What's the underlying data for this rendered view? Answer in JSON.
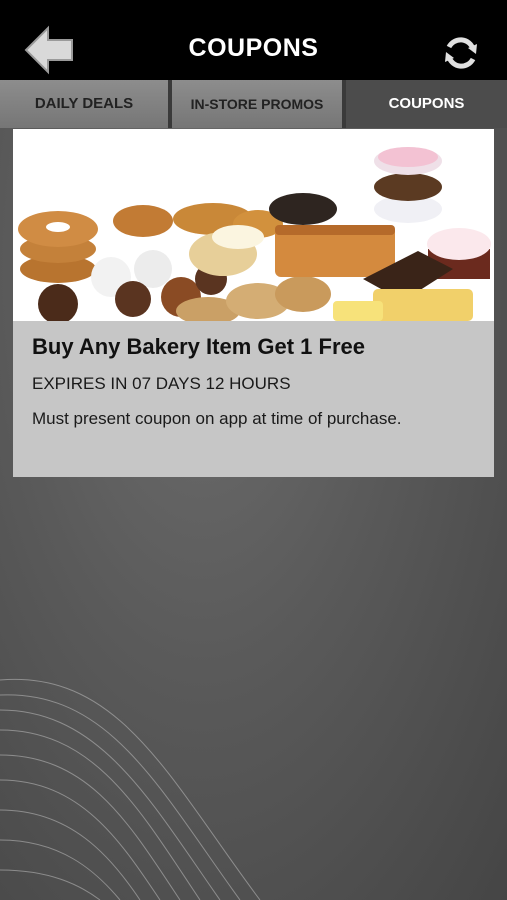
{
  "header": {
    "title": "COUPONS",
    "back_icon": "arrow-left-icon",
    "refresh_icon": "refresh-icon"
  },
  "tabs": [
    {
      "label": "DAILY DEALS",
      "active": false
    },
    {
      "label": "IN-STORE PROMOS",
      "active": false
    },
    {
      "label": "COUPONS",
      "active": true
    }
  ],
  "coupon": {
    "title": "Buy Any Bakery Item Get 1 Free",
    "expires": "EXPIRES IN 07 DAYS 12 HOURS",
    "description": "Must present coupon on app at time of purchase."
  },
  "colors": {
    "topbar": "#000000",
    "active_tab": "#4c4c4c",
    "inactive_tab": "#828282",
    "card": "#c6c6c6"
  }
}
